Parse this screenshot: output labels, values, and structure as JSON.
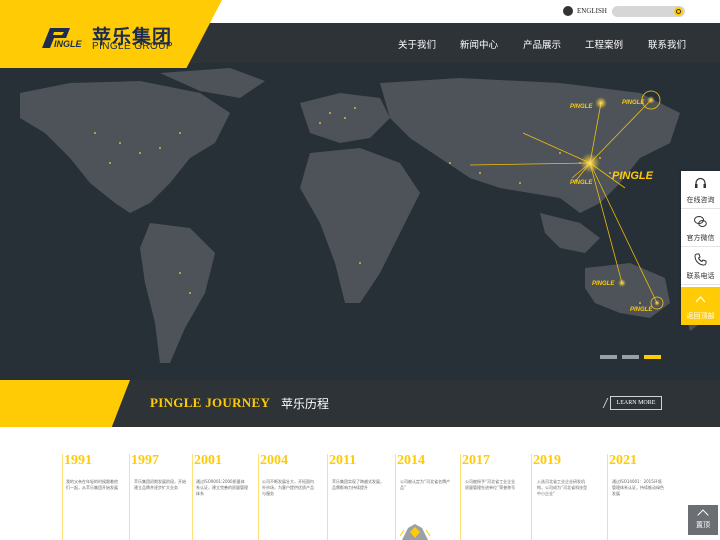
{
  "header": {
    "logo_cn": "苹乐集团",
    "logo_en": "PINGLE GROUP",
    "language_link": "ENGLISH",
    "search_placeholder": "",
    "nav": [
      "关于我们",
      "新闻中心",
      "产品展示",
      "工程案例",
      "联系我们"
    ]
  },
  "hero": {
    "map_brand_label": "PINGLE",
    "slides_count": 3,
    "active_slide": 3
  },
  "sidebar": {
    "items": [
      {
        "label": "在线咨询",
        "icon": "headset-icon"
      },
      {
        "label": "官方微信",
        "icon": "wechat-icon"
      },
      {
        "label": "联系电话",
        "icon": "phone-icon"
      },
      {
        "label": "返回顶部",
        "icon": "arrow-up-icon"
      }
    ]
  },
  "journey": {
    "title_en": "PINGLE JOURNEY",
    "title_cn": "苹乐历程",
    "learn_more": "LEARN MORE"
  },
  "timeline": {
    "years": [
      "1991",
      "1997",
      "2001",
      "2004",
      "2011",
      "2014",
      "2017",
      "2019",
      "2021"
    ],
    "texts": [
      "我的父亲在年轻的时候跟着他们一起，从苹乐集团开始发展",
      "苹乐集团初期发展阶段，开始建立品牌并逐步扩大业务",
      "通过ISO9001:2000质量体系认证，建立完善的质量管理体系",
      "公司不断发展壮大，开拓国内外市场，为客户提供优质产品与服务",
      "苹乐集团实现了跨越式发展，品牌影响力持续提升",
      "公司被认定为“河北省名牌产品”",
      "公司被授予“河北省工业企业质量管理先进单位”荣誉称号",
      "入选河北省工业企业研发机构，公司成为“河北省科技型中小企业”",
      "通过ISO14001：2015环境管理体系认证，持续推动绿色发展"
    ]
  },
  "back_to_top": "置顶",
  "colors": {
    "brand_yellow": "#ffcb05",
    "dark_bar": "#2e3338",
    "logo_navy": "#1d2c4f"
  }
}
